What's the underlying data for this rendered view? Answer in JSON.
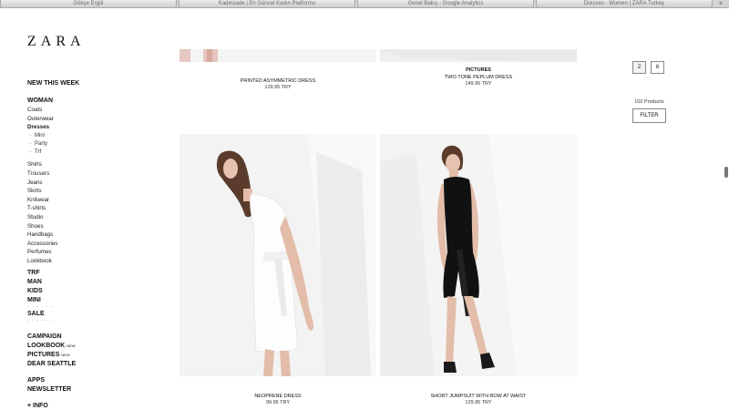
{
  "browser": {
    "tabs": [
      "Gökçe Ergül",
      "Kadınzade | En Güncel Kadın Platformu",
      "Genel Bakış - Google Analytics",
      "Dresses - Women | ZARA Turkey"
    ],
    "new_tab": "+"
  },
  "logo": "ZARA",
  "sidebar": {
    "new_this_week": "NEW THIS WEEK",
    "woman": "WOMAN",
    "woman_items": [
      "Coats",
      "Outerwear"
    ],
    "dresses": "Dresses",
    "dress_subs": [
      "Mini",
      "Party",
      "Trf"
    ],
    "more_items": [
      "Shirts",
      "Trousers",
      "Jeans",
      "Skirts",
      "Knitwear",
      "T-shirts",
      "Studio",
      "Shoes",
      "Handbags",
      "Accessories",
      "Perfumes",
      "Lookbook"
    ],
    "sections": [
      "TRF",
      "MAN",
      "KIDS",
      "MINI"
    ],
    "dots": "- - - - - -",
    "sale": "SALE",
    "campaign": "CAMPAIGN",
    "lookbook": "LOOKBOOK",
    "new_badge": "NEW",
    "pictures": "PICTURES",
    "dear_seattle": "DEAR SEATTLE",
    "apps": "APPS",
    "newsletter": "NEWSLETTER",
    "info": "+ INFO"
  },
  "products": [
    {
      "name": "PRINTED ASYMMETRIC DRESS",
      "price": "129.95 TRY",
      "badge": ""
    },
    {
      "name": "TWO-TONE PEPLUM DRESS",
      "price": "149.95 TRY",
      "badge": "PICTURES"
    },
    {
      "name": "NEOPRENE DRESS",
      "price": "99.95 TRY",
      "badge": ""
    },
    {
      "name": "SHORT JUMPSUIT WITH BOW AT WAIST",
      "price": "129.95 TRY",
      "badge": ""
    }
  ],
  "view": {
    "option_a": "2",
    "option_b": "6"
  },
  "product_count": "102 Products",
  "filter_label": "FILTER"
}
